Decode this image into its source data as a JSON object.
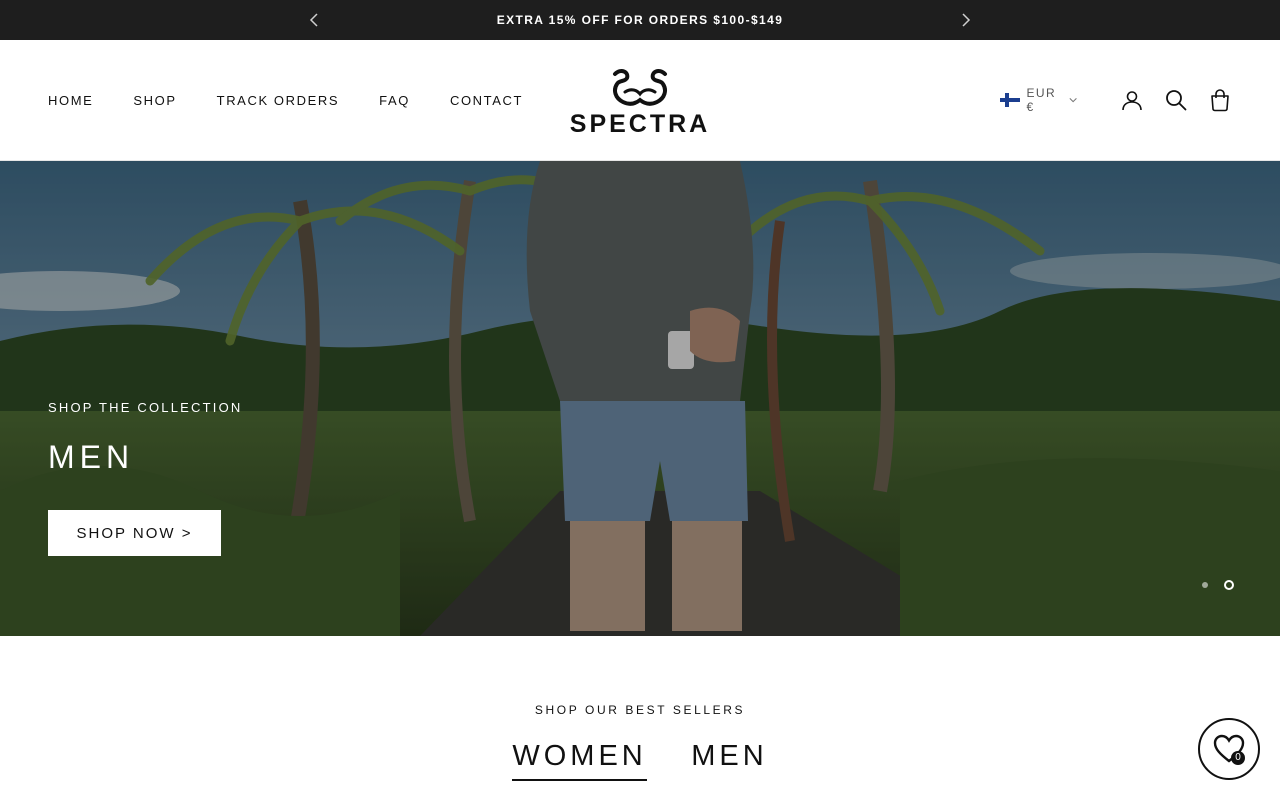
{
  "announcement": {
    "message": "EXTRA 15% OFF FOR ORDERS $100-$149",
    "prev_icon": "chevron-left-icon",
    "next_icon": "chevron-right-icon"
  },
  "header": {
    "nav": [
      {
        "label": "HOME"
      },
      {
        "label": "SHOP"
      },
      {
        "label": "TRACK ORDERS"
      },
      {
        "label": "FAQ"
      },
      {
        "label": "CONTACT"
      }
    ],
    "logo_text": "SPECTRA",
    "currency": "EUR €",
    "icons": [
      "finland-flag-icon",
      "chevron-down-icon",
      "account-icon",
      "search-icon",
      "cart-icon"
    ]
  },
  "hero": {
    "kicker": "SHOP THE COLLECTION",
    "heading": "MEN",
    "cta_label": "SHOP NOW >",
    "slide_count": 2,
    "active_slide": 2
  },
  "best_sellers": {
    "kicker": "SHOP OUR BEST SELLERS",
    "tabs": [
      {
        "label": "WOMEN",
        "active": true
      },
      {
        "label": "MEN",
        "active": false
      }
    ]
  },
  "wishlist": {
    "icon": "heart-icon",
    "count": "0"
  },
  "colors": {
    "announcement_bg": "#1e1e1e",
    "text": "#111111",
    "background": "#ffffff"
  }
}
